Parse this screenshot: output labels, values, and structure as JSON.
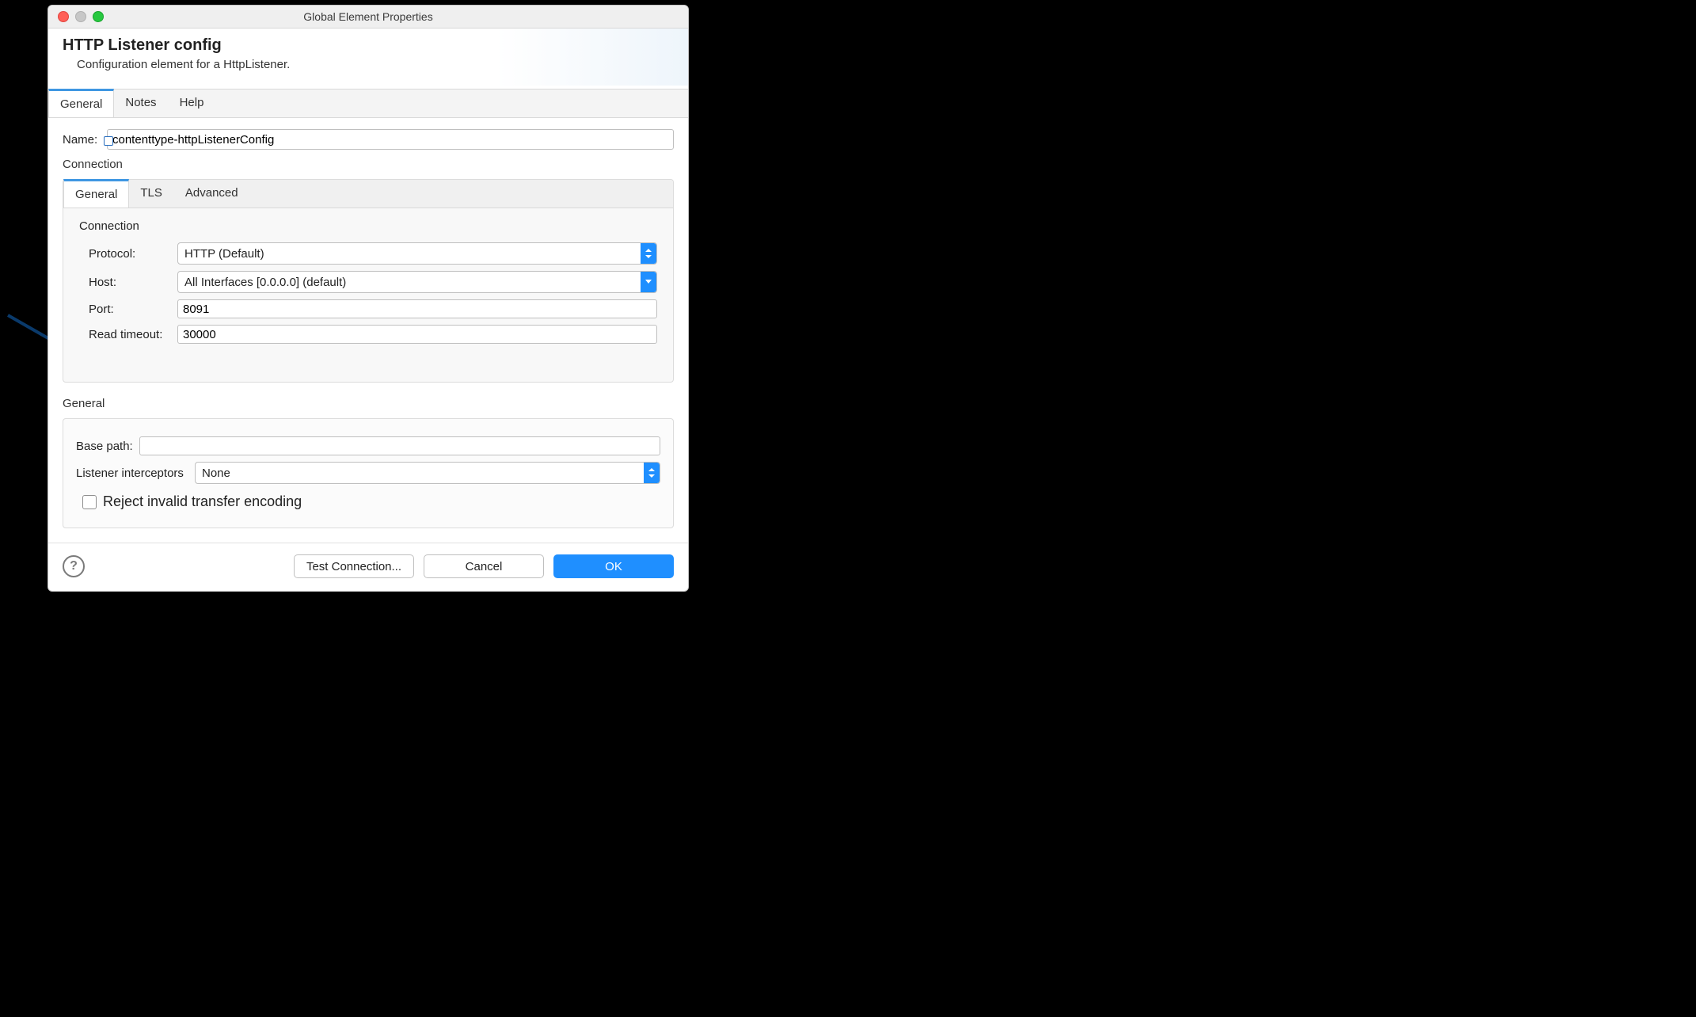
{
  "window": {
    "title": "Global Element Properties"
  },
  "header": {
    "title": "HTTP Listener config",
    "subtitle": "Configuration element for a HttpListener."
  },
  "outer_tabs": {
    "items": [
      "General",
      "Notes",
      "Help"
    ],
    "active": 0
  },
  "name_field": {
    "label": "Name:",
    "value": "contenttype-httpListenerConfig"
  },
  "connection_section_title": "Connection",
  "inner_tabs": {
    "items": [
      "General",
      "TLS",
      "Advanced"
    ],
    "active": 0
  },
  "connection": {
    "title": "Connection",
    "protocol": {
      "label": "Protocol:",
      "value": "HTTP (Default)"
    },
    "host": {
      "label": "Host:",
      "value": "All Interfaces [0.0.0.0] (default)"
    },
    "port": {
      "label": "Port:",
      "value": "8091"
    },
    "read_timeout": {
      "label": "Read timeout:",
      "value": "30000"
    }
  },
  "general_section": {
    "title": "General",
    "base_path": {
      "label": "Base path:",
      "value": ""
    },
    "interceptors": {
      "label": "Listener interceptors",
      "value": "None"
    },
    "reject_checkbox": {
      "label": "Reject invalid transfer encoding",
      "checked": false
    }
  },
  "footer": {
    "test": "Test Connection...",
    "cancel": "Cancel",
    "ok": "OK"
  }
}
